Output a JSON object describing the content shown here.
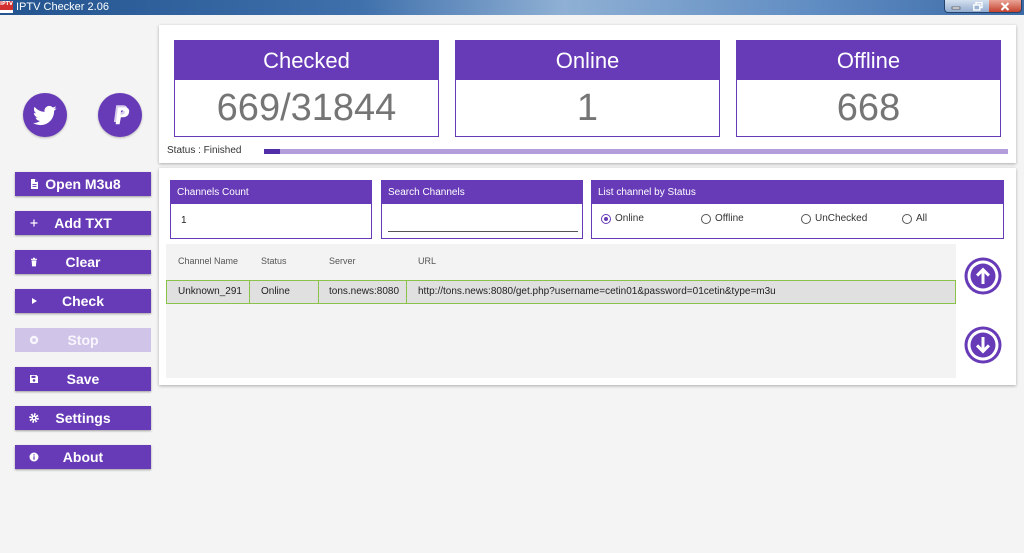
{
  "window": {
    "title": "IPTV Checker 2.06",
    "app_icon": {
      "icon": "iptv-app-icon",
      "text": "IPTV"
    },
    "controls": {
      "minimize": "minimize-icon",
      "restore": "restore-icon",
      "close": "close-icon"
    }
  },
  "theme": {
    "accent": "#673ab7",
    "accent_dark": "#512da8",
    "accent_light": "#b39ddb",
    "disabled": "#d1c4e9",
    "value_text": "#757575",
    "row_border": "#8bc34a",
    "row_bg": "#e0e0e0"
  },
  "sidebar": {
    "social": [
      {
        "icon": "twitter-icon"
      },
      {
        "icon": "paypal-icon"
      }
    ],
    "buttons": [
      {
        "label": "Open M3u8",
        "icon": "file-icon",
        "enabled": true
      },
      {
        "label": "Add TXT",
        "icon": "plus-icon",
        "enabled": true
      },
      {
        "label": "Clear",
        "icon": "trash-icon",
        "enabled": true
      },
      {
        "label": "Check",
        "icon": "play-icon",
        "enabled": true
      },
      {
        "label": "Stop",
        "icon": "stop-icon",
        "enabled": false
      },
      {
        "label": "Save",
        "icon": "save-icon",
        "enabled": true
      },
      {
        "label": "Settings",
        "icon": "gear-icon",
        "enabled": true
      },
      {
        "label": "About",
        "icon": "info-icon",
        "enabled": true
      }
    ]
  },
  "stats": {
    "checked": {
      "label": "Checked",
      "value": "669/31844"
    },
    "online": {
      "label": "Online",
      "value": "1"
    },
    "offline": {
      "label": "Offline",
      "value": "668"
    }
  },
  "status": {
    "text": "Status : Finished",
    "progress": 0.021
  },
  "filters": {
    "channels_count": {
      "label": "Channels Count",
      "value": "1"
    },
    "search": {
      "label": "Search Channels",
      "value": ""
    },
    "status_filter": {
      "label": "List channel by Status",
      "options": [
        "Online",
        "Offline",
        "UnChecked",
        "All"
      ],
      "selected": "Online"
    }
  },
  "table": {
    "columns": [
      "Channel Name",
      "Status",
      "Server",
      "URL"
    ],
    "rows": [
      {
        "channel_name": "Unknown_291",
        "status": "Online",
        "server": "tons.news:8080",
        "url": "http://tons.news:8080/get.php?username=cetin01&password=01cetin&type=m3u"
      }
    ]
  },
  "scroll": {
    "up_icon": "arrow-up-circle-icon",
    "down_icon": "arrow-down-circle-icon"
  }
}
